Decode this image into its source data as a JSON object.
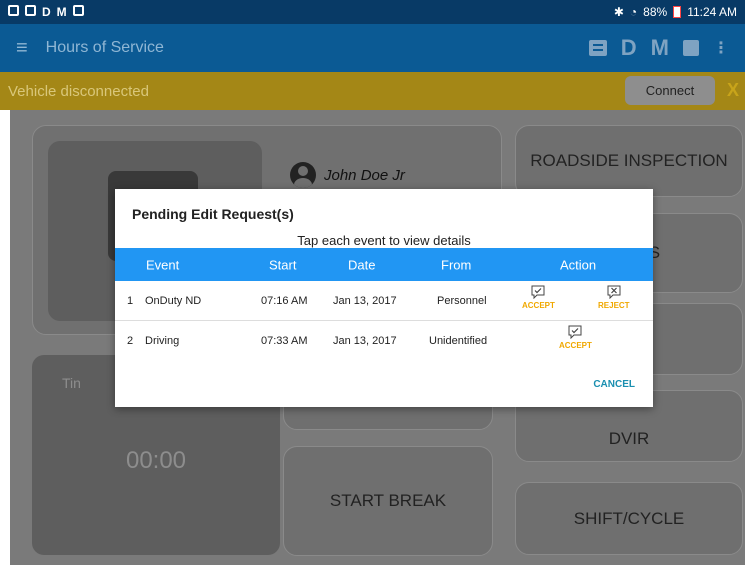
{
  "statusbar": {
    "left_icons": [
      "D",
      "M"
    ],
    "battery": "88%",
    "time": "11:24 AM"
  },
  "appbar": {
    "title": "Hours of Service",
    "action_d": "D",
    "action_m": "M"
  },
  "warning": {
    "text": "Vehicle disconnected",
    "connect_label": "Connect",
    "close_label": "X"
  },
  "dashboard": {
    "driver_name": "John Doe Jr",
    "timer_label": "Tin",
    "timer_value": "00:00",
    "tiles": {
      "roadside": "ROADSIDE INSPECTION",
      "status": "IS",
      "dvir": "DVIR",
      "start_break": "START BREAK",
      "shift_cycle": "SHIFT/CYCLE"
    }
  },
  "dialog": {
    "title": "Pending Edit Request(s)",
    "subtitle": "Tap each event to view details",
    "headers": {
      "event": "Event",
      "start": "Start",
      "date": "Date",
      "from": "From",
      "action": "Action"
    },
    "rows": [
      {
        "num": "1",
        "event": "OnDuty ND",
        "start": "07:16 AM",
        "date": "Jan 13, 2017",
        "from": "Personnel",
        "accept": "ACCEPT",
        "reject": "REJECT"
      },
      {
        "num": "2",
        "event": "Driving",
        "start": "07:33 AM",
        "date": "Jan 13, 2017",
        "from": "Unidentified",
        "accept": "ACCEPT"
      }
    ],
    "cancel_label": "CANCEL"
  },
  "colors": {
    "accent": "#2196f3",
    "action": "#f0a800",
    "cancel": "#1a8fb0",
    "appbar": "#0b5a94"
  }
}
